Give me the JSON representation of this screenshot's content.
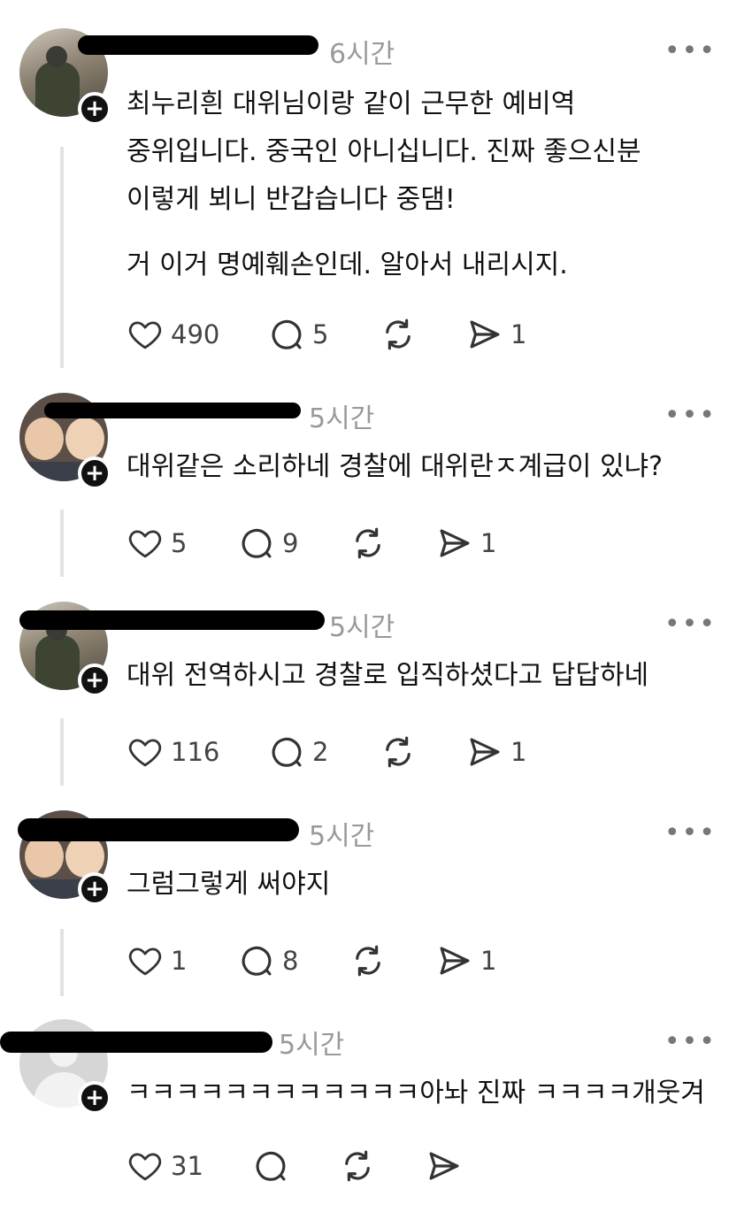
{
  "posts": [
    {
      "time": "6시간",
      "lines": [
        "최누리흰 대위님이랑 같이 근무한 예비역",
        "중위입니다. 중국인 아니십니다. 진짜 좋으신분",
        "이렇게 뵈니 반갑습니다 중댐!",
        "",
        "거 이거 명예훼손인데. 알아서 내리시지."
      ],
      "likes": "490",
      "comments": "5",
      "shares": "1"
    },
    {
      "time": "5시간",
      "lines": [
        "대위같은 소리하네 경찰에 대위란ㅈ계급이 있냐?"
      ],
      "likes": "5",
      "comments": "9",
      "shares": "1"
    },
    {
      "time": "5시간",
      "lines": [
        "대위 전역하시고 경찰로 입직하셨다고 답답하네"
      ],
      "likes": "116",
      "comments": "2",
      "shares": "1"
    },
    {
      "time": "5시간",
      "lines": [
        "그럼그렇게 써야지"
      ],
      "likes": "1",
      "comments": "8",
      "shares": "1"
    },
    {
      "time": "5시간",
      "lines": [
        "ㅋㅋㅋㅋㅋㅋㅋㅋㅋㅋㅋㅋ아놔 진짜 ㅋㅋㅋㅋ개웃겨"
      ],
      "likes": "31",
      "comments": "",
      "shares": ""
    }
  ],
  "more_label": "•••",
  "plus_label": "+",
  "colors": {
    "text": "#111111",
    "muted": "#999999",
    "icon": "#333333",
    "thread": "#e2e2e2"
  },
  "icons": [
    "heart-icon",
    "comment-icon",
    "repost-icon",
    "send-icon",
    "more-icon",
    "follow-plus-icon"
  ]
}
